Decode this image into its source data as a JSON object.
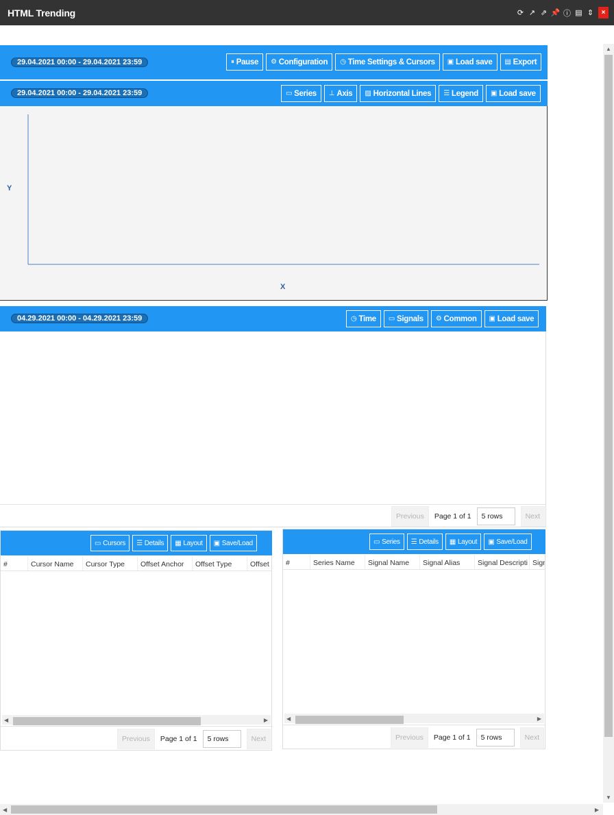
{
  "window": {
    "title": "HTML Trending"
  },
  "main_toolbar": {
    "range": "29.04.2021 00:00 - 29.04.2021 23:59",
    "buttons": [
      "Pause",
      "Configuration",
      "Time Settings & Cursors",
      "Load save",
      "Export"
    ]
  },
  "chart_toolbar": {
    "range": "29.04.2021 00:00 - 29.04.2021 23:59",
    "buttons": [
      "Series",
      "Axis",
      "Horizontal Lines",
      "Legend",
      "Load save"
    ]
  },
  "chart": {
    "y_label": "Y",
    "x_label": "X"
  },
  "table_toolbar": {
    "range": "04.29.2021 00:00 - 04.29.2021 23:59",
    "buttons": [
      "Time",
      "Signals",
      "Common",
      "Load save"
    ]
  },
  "table_pager": {
    "previous": "Previous",
    "page": "Page 1 of 1",
    "rows": "5 rows",
    "next": "Next"
  },
  "cursor_panel": {
    "buttons": [
      "Cursors",
      "Details",
      "Layout",
      "Save/Load"
    ],
    "columns": [
      "#",
      "Cursor Name",
      "Cursor Type",
      "Offset Anchor",
      "Offset Type",
      "Offset"
    ],
    "pager": {
      "previous": "Previous",
      "page": "Page 1 of 1",
      "rows": "5 rows",
      "next": "Next"
    }
  },
  "series_panel": {
    "buttons": [
      "Series",
      "Details",
      "Layout",
      "Save/Load"
    ],
    "columns": [
      "#",
      "Series Name",
      "Signal Name",
      "Signal Alias",
      "Signal Descripti",
      "Sign"
    ],
    "pager": {
      "previous": "Previous",
      "page": "Page 1 of 1",
      "rows": "5 rows",
      "next": "Next"
    }
  }
}
